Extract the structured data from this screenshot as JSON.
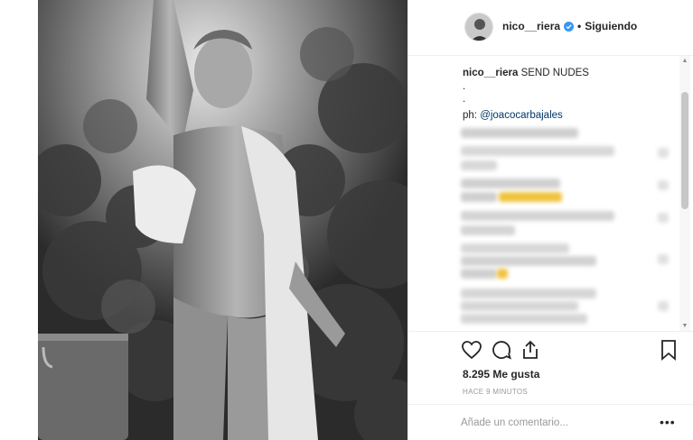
{
  "post": {
    "author": "nico__riera",
    "follow_status": "Siguiendo",
    "separator": "•",
    "caption_user": "nico__riera",
    "caption_text": "SEND NUDES",
    "caption_dots": [
      ".",
      "."
    ],
    "photo_credit_prefix": "ph: ",
    "photo_credit_handle": "@joacocarbajales",
    "likes": "8.295 Me gusta",
    "timestamp": "HACE 9 MINUTOS",
    "comment_placeholder": "Añade un comentario...",
    "more_options": "•••"
  },
  "icons": {
    "verified": "verified-badge-icon",
    "like": "heart-icon",
    "comment": "comment-bubble-icon",
    "share": "share-icon",
    "save": "bookmark-icon",
    "more": "ellipsis-icon"
  },
  "colors": {
    "text": "#262626",
    "link": "#003569",
    "muted": "#999999",
    "verified": "#3897f0",
    "border": "#efefef",
    "blurred_highlight": "#f0c23c"
  }
}
